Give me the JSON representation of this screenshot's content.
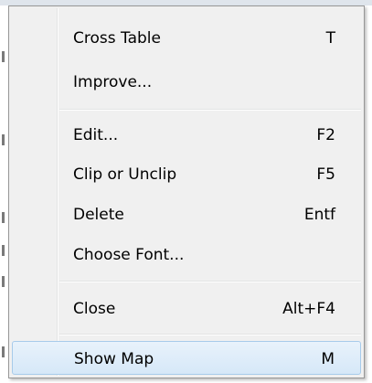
{
  "menu": {
    "items": [
      {
        "label": "Cross Table",
        "shortcut": "T"
      },
      {
        "label": "Improve...",
        "shortcut": ""
      },
      {
        "label": "Edit...",
        "shortcut": "F2"
      },
      {
        "label": "Clip or Unclip",
        "shortcut": "F5"
      },
      {
        "label": "Delete",
        "shortcut": "Entf"
      },
      {
        "label": "Choose Font...",
        "shortcut": ""
      },
      {
        "label": "Close",
        "shortcut": "Alt+F4"
      },
      {
        "label": "Show Map",
        "shortcut": "M"
      }
    ],
    "highlighted_item": "Show Map"
  },
  "colors": {
    "menu_background": "#f0f0f0",
    "menu_border": "#979797",
    "highlight_border": "#a7cbea",
    "highlight_fill": "#d6e8f8"
  }
}
